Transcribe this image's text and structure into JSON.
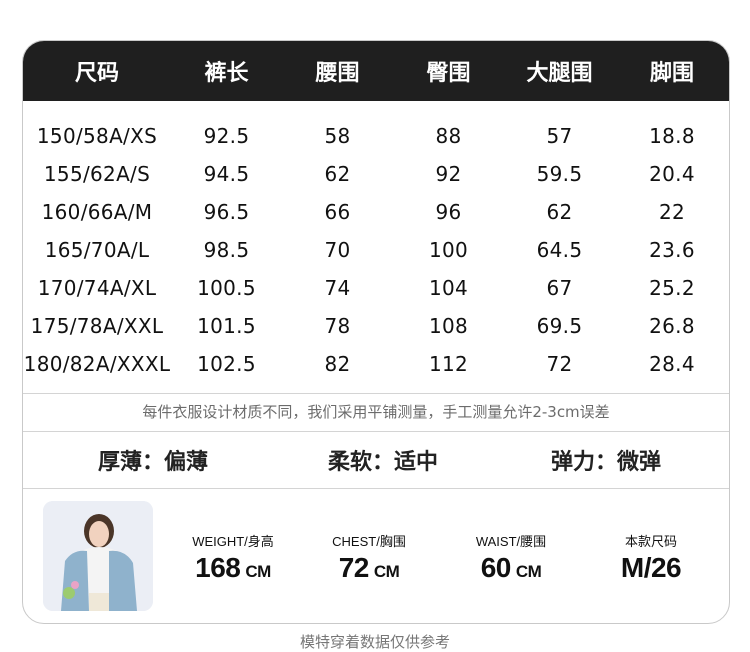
{
  "size_table": {
    "headers": [
      "尺码",
      "裤长",
      "腰围",
      "臀围",
      "大腿围",
      "脚围"
    ],
    "rows": [
      [
        "150/58A/XS",
        "92.5",
        "58",
        "88",
        "57",
        "18.8"
      ],
      [
        "155/62A/S",
        "94.5",
        "62",
        "92",
        "59.5",
        "20.4"
      ],
      [
        "160/66A/M",
        "96.5",
        "66",
        "96",
        "62",
        "22"
      ],
      [
        "165/70A/L",
        "98.5",
        "70",
        "100",
        "64.5",
        "23.6"
      ],
      [
        "170/74A/XL",
        "100.5",
        "74",
        "104",
        "67",
        "25.2"
      ],
      [
        "175/78A/XXL",
        "101.5",
        "78",
        "108",
        "69.5",
        "26.8"
      ],
      [
        "180/82A/XXXL",
        "102.5",
        "82",
        "112",
        "72",
        "28.4"
      ]
    ]
  },
  "note": "每件衣服设计材质不同，我们采用平铺测量，手工测量允许2-3cm误差",
  "fabric_feel": [
    {
      "label": "厚薄：偏薄"
    },
    {
      "label": "柔软：适中"
    },
    {
      "label": "弹力：微弹"
    }
  ],
  "model": {
    "weight_label": "WEIGHT/身高",
    "weight_value": "168",
    "weight_unit": "CM",
    "chest_label": "CHEST/胸围",
    "chest_value": "72",
    "chest_unit": "CM",
    "waist_label": "WAIST/腰围",
    "waist_value": "60",
    "waist_unit": "CM",
    "size_label": "本款尺码",
    "size_value": "M/26"
  },
  "footer_note": "模特穿着数据仅供参考",
  "colors": {
    "header_bg": "#1f1f1f",
    "header_text": "#ffffff",
    "border": "#c9c9c9",
    "note_text": "#6c6c6c"
  }
}
